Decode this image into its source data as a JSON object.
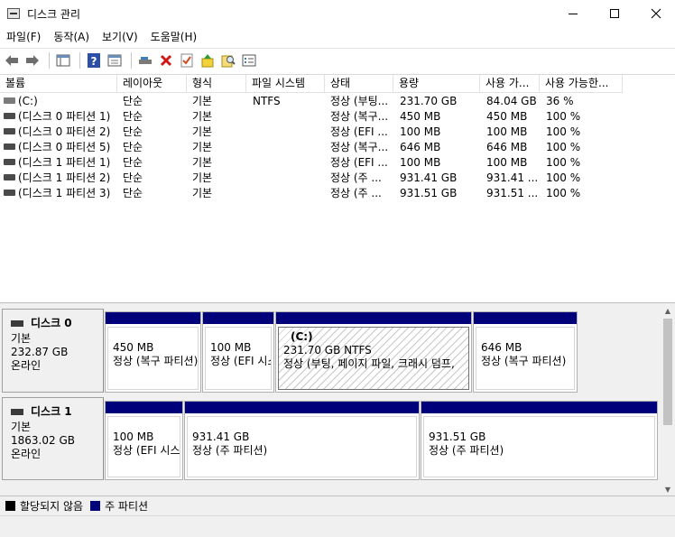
{
  "window": {
    "title": "디스크 관리"
  },
  "menu": [
    "파일(F)",
    "동작(A)",
    "보기(V)",
    "도움말(H)"
  ],
  "toolbar": {
    "icons": [
      "back-arrow-icon",
      "forward-arrow-icon",
      "console-tree-icon",
      "help-icon",
      "properties-icon",
      "connect-drive-icon",
      "delete-icon",
      "check-icon",
      "up-arrow-icon",
      "search-icon",
      "list-icon"
    ]
  },
  "columns": [
    "볼륨",
    "레이아웃",
    "형식",
    "파일 시스템",
    "상태",
    "용량",
    "사용 가...",
    "사용 가능한..."
  ],
  "volumes": [
    [
      "(C:)",
      "단순",
      "기본",
      "NTFS",
      "정상 (부팅...",
      "231.70 GB",
      "84.04 GB",
      "36 %"
    ],
    [
      "(디스크 0 파티션 1)",
      "단순",
      "기본",
      "",
      "정상 (복구...",
      "450 MB",
      "450 MB",
      "100 %"
    ],
    [
      "(디스크 0 파티션 2)",
      "단순",
      "기본",
      "",
      "정상 (EFI ...",
      "100 MB",
      "100 MB",
      "100 %"
    ],
    [
      "(디스크 0 파티션 5)",
      "단순",
      "기본",
      "",
      "정상 (복구...",
      "646 MB",
      "646 MB",
      "100 %"
    ],
    [
      "(디스크 1 파티션 1)",
      "단순",
      "기본",
      "",
      "정상 (EFI ...",
      "100 MB",
      "100 MB",
      "100 %"
    ],
    [
      "(디스크 1 파티션 2)",
      "단순",
      "기본",
      "",
      "정상 (주 ...",
      "931.41 GB",
      "931.41 ...",
      "100 %"
    ],
    [
      "(디스크 1 파티션 3)",
      "단순",
      "기본",
      "",
      "정상 (주 ...",
      "931.51 GB",
      "931.51 ...",
      "100 %"
    ]
  ],
  "disks": [
    {
      "name": "디스크 0",
      "type": "기본",
      "size": "232.87 GB",
      "status": "온라인",
      "partitions": [
        {
          "label": "",
          "size": "450 MB",
          "status": "정상 (복구 파티션)"
        },
        {
          "label": "",
          "size": "100 MB",
          "status": "정상 (EFI 시스"
        },
        {
          "label": "(C:)",
          "size": "231.70 GB NTFS",
          "status": "정상 (부팅, 페이지 파일, 크래시 덤프,"
        },
        {
          "label": "",
          "size": "646 MB",
          "status": "정상 (복구 파티션)"
        }
      ]
    },
    {
      "name": "디스크 1",
      "type": "기본",
      "size": "1863.02 GB",
      "status": "온라인",
      "partitions": [
        {
          "label": "",
          "size": "100 MB",
          "status": "정상 (EFI 시스"
        },
        {
          "label": "",
          "size": "931.41 GB",
          "status": "정상 (주 파티션)"
        },
        {
          "label": "",
          "size": "931.51 GB",
          "status": "정상 (주 파티션)"
        }
      ]
    }
  ],
  "legend": [
    {
      "label": "할당되지 않음",
      "color": "#000000"
    },
    {
      "label": "주 파티션",
      "color": "#00007b"
    }
  ]
}
